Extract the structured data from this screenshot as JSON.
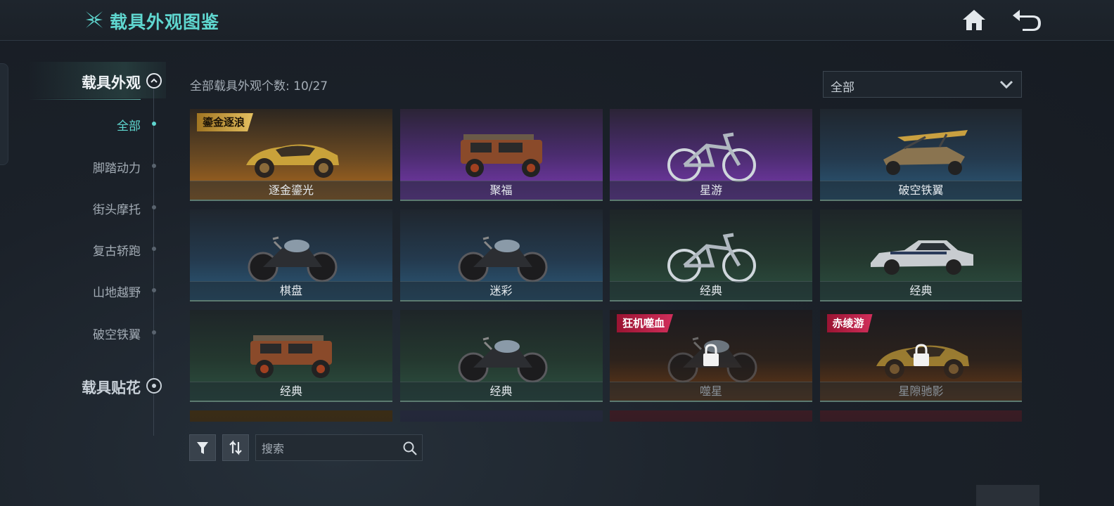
{
  "header": {
    "title": "载具外观图鉴",
    "logo_icon": "star-logo-icon",
    "home_icon": "home-icon",
    "back_icon": "back-arrow-icon",
    "accent_color": "#5fd6cf"
  },
  "sidebar": {
    "sections": [
      {
        "label": "载具外观",
        "expanded": true,
        "icon": "chevron-up-icon"
      },
      {
        "label": "载具贴花",
        "expanded": false,
        "icon": "radio-dot-icon"
      }
    ],
    "items": [
      {
        "label": "全部",
        "active": true
      },
      {
        "label": "脚踏动力",
        "active": false
      },
      {
        "label": "街头摩托",
        "active": false
      },
      {
        "label": "复古轿跑",
        "active": false
      },
      {
        "label": "山地越野",
        "active": false
      },
      {
        "label": "破空铁翼",
        "active": false
      }
    ]
  },
  "main": {
    "count_text": "全部载具外观个数: 10/27",
    "filter_select": {
      "selected": "全部"
    },
    "cards": [
      {
        "name": "逐金鎏光",
        "tag": "鎏金逐浪",
        "tag_style": "gold",
        "theme": "gold",
        "vehicle": "sports-car-icon",
        "locked": false
      },
      {
        "name": "聚福",
        "tag": "",
        "theme": "purple",
        "vehicle": "jeep-icon",
        "locked": false
      },
      {
        "name": "星游",
        "tag": "",
        "theme": "purple",
        "vehicle": "bicycle-icon",
        "locked": false
      },
      {
        "name": "破空铁翼",
        "tag": "",
        "theme": "blue",
        "vehicle": "glider-buggy-icon",
        "locked": false
      },
      {
        "name": "棋盘",
        "tag": "",
        "theme": "blue",
        "vehicle": "motorcycle-icon",
        "locked": false
      },
      {
        "name": "迷彩",
        "tag": "",
        "theme": "blue",
        "vehicle": "motorcycle-icon",
        "locked": false
      },
      {
        "name": "经典",
        "tag": "",
        "theme": "green",
        "vehicle": "bicycle-icon",
        "locked": false
      },
      {
        "name": "经典",
        "tag": "",
        "theme": "green",
        "vehicle": "classic-car-icon",
        "locked": false
      },
      {
        "name": "经典",
        "tag": "",
        "theme": "green",
        "vehicle": "jeep-icon",
        "locked": false
      },
      {
        "name": "经典",
        "tag": "",
        "theme": "green",
        "vehicle": "motorcycle-icon",
        "locked": false
      },
      {
        "name": "噬星",
        "tag": "狂机噬血",
        "tag_style": "red",
        "theme": "dark-orange",
        "vehicle": "motorcycle-icon",
        "locked": true
      },
      {
        "name": "星隙驰影",
        "tag": "赤绫游",
        "tag_style": "red",
        "theme": "dark-orange",
        "vehicle": "sports-car-icon",
        "locked": true
      },
      {
        "name": "",
        "tag": "",
        "theme": "gold-dark",
        "vehicle": "",
        "locked": false
      },
      {
        "name": "",
        "tag": "",
        "theme": "dark-blue",
        "vehicle": "",
        "locked": false
      },
      {
        "name": "",
        "tag": "",
        "theme": "dark-red",
        "vehicle": "",
        "locked": false
      },
      {
        "name": "",
        "tag": "",
        "theme": "dark-red",
        "vehicle": "",
        "locked": false
      }
    ]
  },
  "toolbar": {
    "filter_icon": "filter-icon",
    "sort_icon": "sort-icon",
    "search": {
      "placeholder": "搜索",
      "value": "",
      "icon": "search-icon"
    }
  }
}
